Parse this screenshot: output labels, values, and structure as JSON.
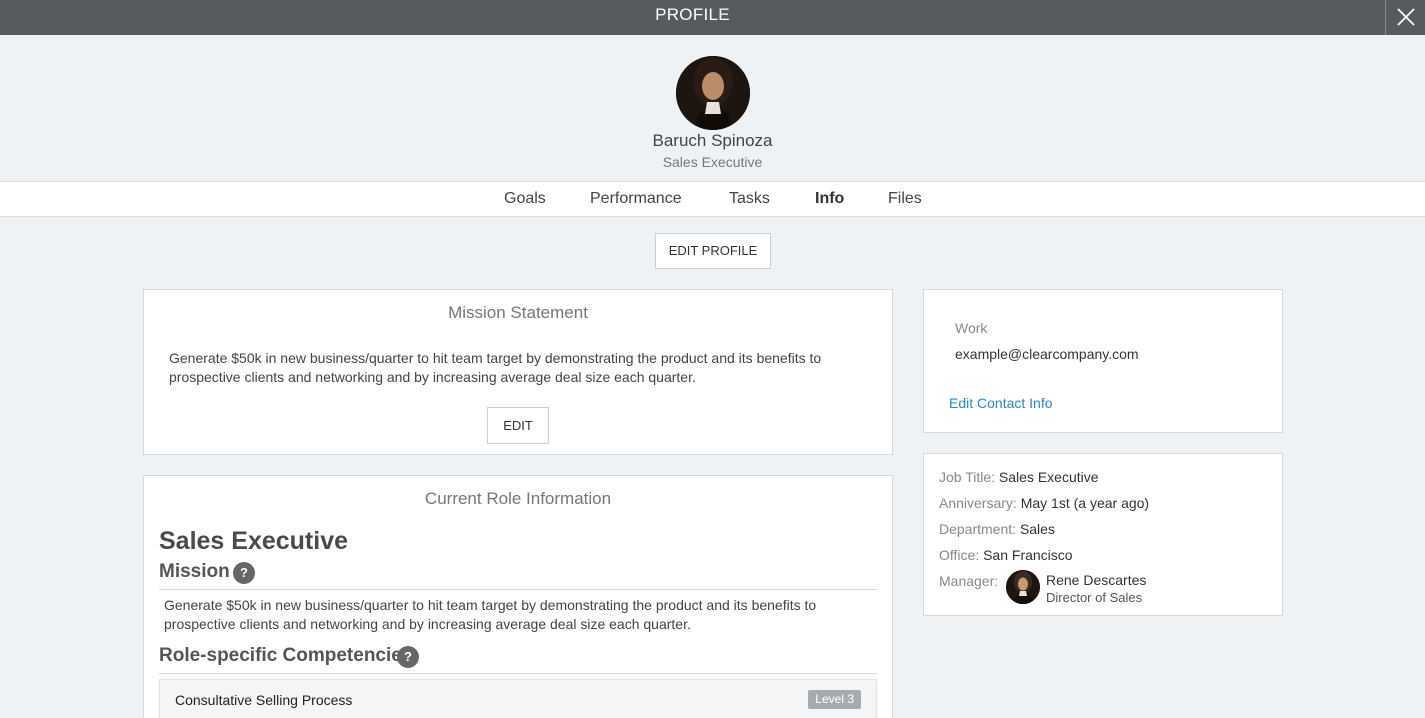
{
  "topbar": {
    "title": "PROFILE"
  },
  "profile": {
    "name": "Baruch Spinoza",
    "title": "Sales Executive"
  },
  "tabs": [
    {
      "label": "Goals",
      "active": false
    },
    {
      "label": "Performance",
      "active": false
    },
    {
      "label": "Tasks",
      "active": false
    },
    {
      "label": "Info",
      "active": true
    },
    {
      "label": "Files",
      "active": false
    }
  ],
  "edit_profile_label": "EDIT PROFILE",
  "mission": {
    "title": "Mission Statement",
    "text": "Generate $50k in new business/quarter to hit team target by demonstrating the product and its benefits to prospective clients and networking and by increasing average deal size each quarter.",
    "edit_label": "EDIT"
  },
  "role": {
    "title": "Current Role Information",
    "role_name": "Sales Executive",
    "mission_heading": "Mission",
    "mission_text": "Generate $50k in new business/quarter to hit team target by demonstrating the product and its benefits to prospective clients and networking and by increasing average deal size each quarter.",
    "competencies_heading": "Role-specific Competencies",
    "help_glyph": "?",
    "competencies": [
      {
        "name": "Consultative Selling Process",
        "level": "Level 3"
      }
    ]
  },
  "contact": {
    "work_label": "Work",
    "work_email": "example@clearcompany.com",
    "edit_link": "Edit Contact Info"
  },
  "details": {
    "job_title_label": "Job Title:",
    "job_title": "Sales Executive",
    "anniversary_label": "Anniversary:",
    "anniversary": "May 1st (a year ago)",
    "department_label": "Department:",
    "department": "Sales",
    "office_label": "Office:",
    "office": "San Francisco",
    "manager_label": "Manager:",
    "manager_name": "Rene Descartes",
    "manager_title": "Director of Sales"
  },
  "colors": {
    "topbar": "#585b5e",
    "link": "#2f86c4",
    "background": "#eff2f5"
  }
}
